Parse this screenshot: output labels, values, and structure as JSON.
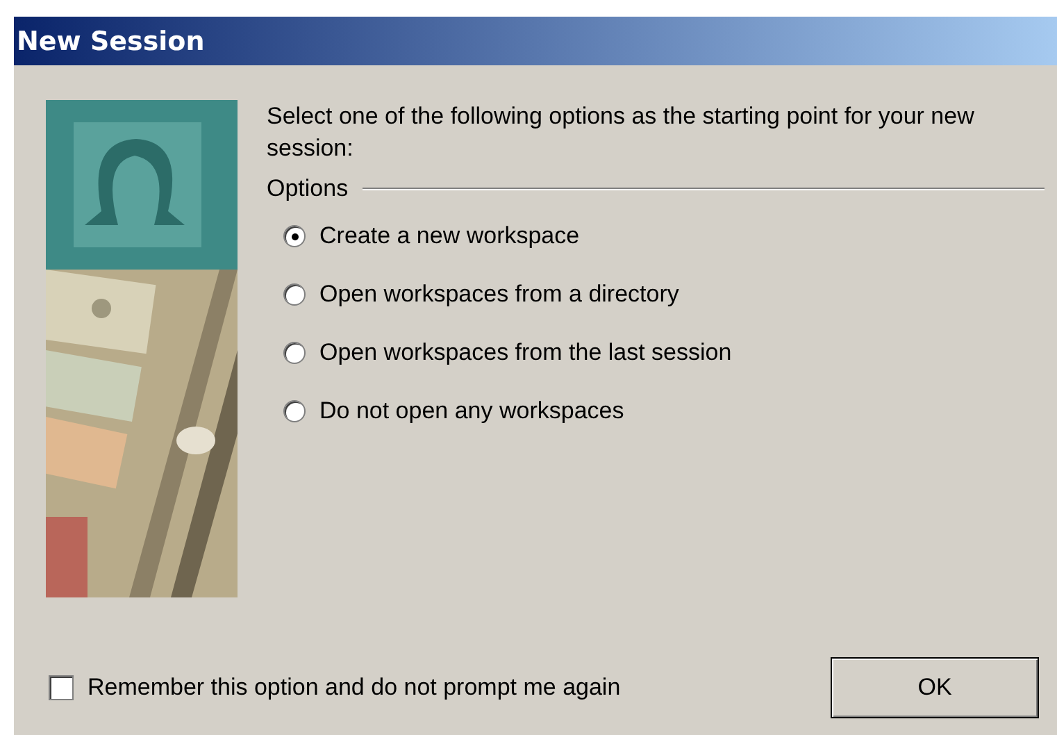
{
  "window": {
    "title": "New Session"
  },
  "intro": "Select one of the following options as the starting point for your new session:",
  "options_group": {
    "label": "Options",
    "options": [
      {
        "label": "Create a new workspace",
        "selected": true
      },
      {
        "label": "Open workspaces from a directory",
        "selected": false
      },
      {
        "label": "Open workspaces from the last session",
        "selected": false
      },
      {
        "label": "Do not open any workspaces",
        "selected": false
      }
    ]
  },
  "remember": {
    "label": "Remember this option and do not prompt me again",
    "checked": false
  },
  "buttons": [
    "OK"
  ]
}
